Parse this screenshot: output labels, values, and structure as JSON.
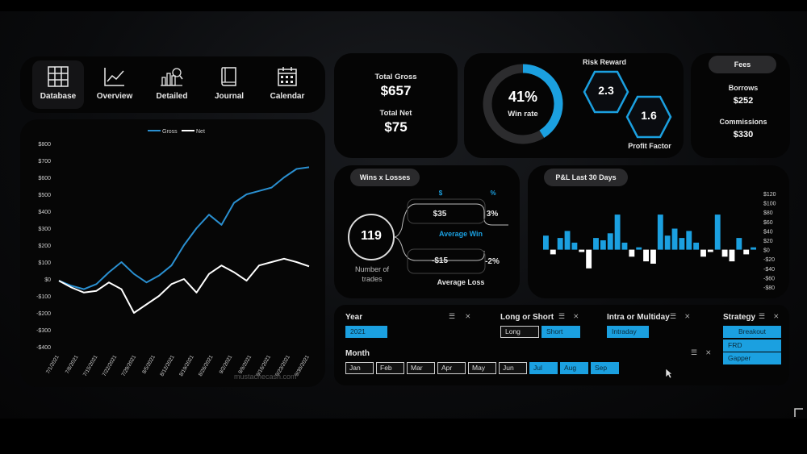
{
  "nav": [
    {
      "label": "Database",
      "icon": "database-icon"
    },
    {
      "label": "Overview",
      "icon": "chart-line-icon"
    },
    {
      "label": "Detailed",
      "icon": "detailed-chart-icon"
    },
    {
      "label": "Journal",
      "icon": "journal-book-icon"
    },
    {
      "label": "Calendar",
      "icon": "calendar-icon"
    }
  ],
  "totals": {
    "gross_label": "Total Gross",
    "gross_value": "$657",
    "net_label": "Total Net",
    "net_value": "$75"
  },
  "winrate": {
    "value": "41%",
    "label": "Win rate",
    "fraction": 0.41
  },
  "risk": {
    "risk_reward_label": "Risk Reward",
    "risk_reward_value": "2.3",
    "profit_factor_label": "Profit Factor",
    "profit_factor_value": "1.6"
  },
  "fees": {
    "title": "Fees",
    "borrows_label": "Borrows",
    "borrows_value": "$252",
    "commissions_label": "Commissions",
    "commissions_value": "$330"
  },
  "wins": {
    "title": "Wins x Losses",
    "col_dollar": "$",
    "col_pct": "%",
    "trades_value": "119",
    "trades_label": "Number of trades",
    "avg_win_dollar": "$35",
    "avg_win_pct": "3%",
    "avg_win_label": "Average Win",
    "avg_loss_dollar": "-$15",
    "avg_loss_pct": "-2%",
    "avg_loss_label": "Average Loss"
  },
  "pnl_title": "P&L Last 30 Days",
  "slicers": {
    "year_title": "Year",
    "year_values": [
      "2021"
    ],
    "long_short_title": "Long or Short",
    "long_short_values": [
      "Long",
      "Short"
    ],
    "intra_title": "Intra or Multiday",
    "intra_values": [
      "Intraday"
    ],
    "strategy_title": "Strategy",
    "strategy_values": [
      "Breakout",
      "FRD",
      "Gapper"
    ],
    "month_title": "Month",
    "months": [
      "Jan",
      "Feb",
      "Mar",
      "Apr",
      "May",
      "Jun",
      "Jul",
      "Aug",
      "Sep"
    ],
    "months_selected": [
      false,
      false,
      false,
      false,
      false,
      false,
      true,
      true,
      true
    ]
  },
  "watermark": "mustachecash.com",
  "colors": {
    "accent": "#1ba0e0",
    "card": "#050505",
    "gross_line": "#2a8fd0",
    "net_line": "#ffffff"
  },
  "chart_data": [
    {
      "type": "line",
      "title": "",
      "series": [
        {
          "name": "Gross",
          "values": [
            -10,
            -40,
            -60,
            -30,
            40,
            100,
            30,
            -20,
            20,
            80,
            200,
            300,
            380,
            320,
            450,
            500,
            520,
            540,
            600,
            650,
            660
          ]
        },
        {
          "name": "Net",
          "values": [
            -10,
            -50,
            -80,
            -70,
            -20,
            -60,
            -200,
            -150,
            -100,
            -30,
            0,
            -80,
            30,
            80,
            40,
            -10,
            80,
            100,
            120,
            100,
            75
          ]
        }
      ],
      "x_tick_labels": [
        "7/1/2021",
        "7/8/2021",
        "7/15/2021",
        "7/22/2021",
        "7/29/2021",
        "8/5/2021",
        "8/12/2021",
        "8/19/2021",
        "8/26/2021",
        "9/2/2021",
        "9/9/2021",
        "9/16/2021",
        "9/23/2021",
        "9/30/2021"
      ],
      "y_tick_labels": [
        "$800",
        "$700",
        "$600",
        "$500",
        "$400",
        "$300",
        "$200",
        "$100",
        "$0",
        "-$100",
        "-$200",
        "-$300",
        "-$400"
      ],
      "ylim": [
        -400,
        800
      ],
      "legend": "top"
    },
    {
      "type": "bar",
      "title": "P&L Last 30 Days",
      "values": [
        30,
        -10,
        25,
        40,
        15,
        -5,
        -40,
        25,
        20,
        35,
        75,
        15,
        -15,
        5,
        -25,
        -30,
        75,
        30,
        45,
        25,
        40,
        15,
        -15,
        -5,
        75,
        -15,
        -25,
        25,
        -10,
        5
      ],
      "y_tick_labels": [
        "$120",
        "$100",
        "$80",
        "$60",
        "$40",
        "$20",
        "$0",
        "-$20",
        "-$40",
        "-$60",
        "-$80"
      ],
      "ylim": [
        -80,
        120
      ]
    }
  ]
}
